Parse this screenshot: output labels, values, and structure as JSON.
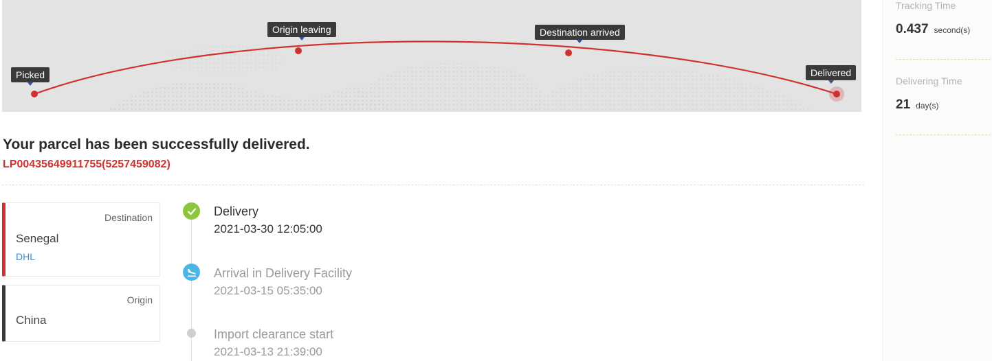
{
  "route": {
    "stops": [
      {
        "label": "Picked"
      },
      {
        "label": "Origin leaving"
      },
      {
        "label": "Destination arrived"
      },
      {
        "label": "Delivered"
      }
    ],
    "line_color": "#d0312d"
  },
  "stats": {
    "tracking_time": {
      "label": "Tracking Time",
      "value": "0.437",
      "unit": "second(s)"
    },
    "delivering_time": {
      "label": "Delivering Time",
      "value": "21",
      "unit": "day(s)"
    }
  },
  "parcel": {
    "status_message": "Your parcel has been successfully delivered.",
    "tracking_number": "LP00435649911755(5257459082)"
  },
  "destination": {
    "kind": "Destination",
    "country": "Senegal",
    "carrier": "DHL"
  },
  "origin": {
    "kind": "Origin",
    "country": "China"
  },
  "timeline": [
    {
      "title": "Delivery",
      "time": "2021-03-30 12:05:00",
      "icon": "check-icon"
    },
    {
      "title": "Arrival in Delivery Facility",
      "time": "2021-03-15 05:35:00",
      "icon": "plane-landing-icon"
    },
    {
      "title": "Import clearance start",
      "time": "2021-03-13 21:39:00",
      "icon": "dot-icon"
    }
  ],
  "colors": {
    "accent_red": "#d0312d",
    "done_green": "#8cc63f",
    "transit_blue": "#4cb6e6",
    "link_blue": "#3a8fd6"
  }
}
